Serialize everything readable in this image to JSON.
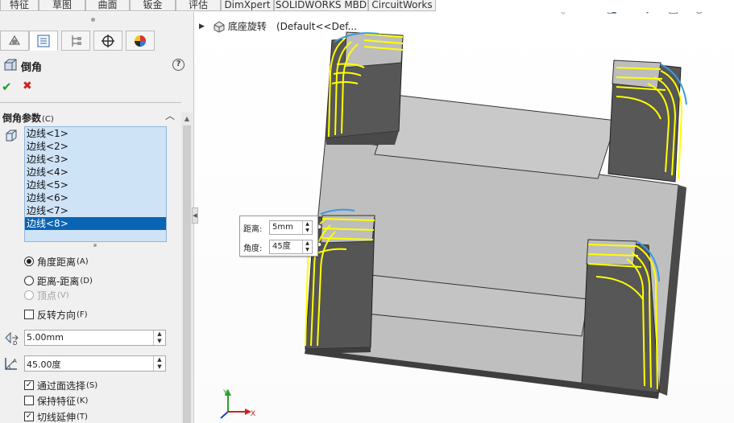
{
  "tabs": [
    "特征",
    "草图",
    "曲面",
    "钣金",
    "评估",
    "DimXpert",
    "SOLIDWORKS MBD",
    "CircuitWorks"
  ],
  "property_manager": {
    "title": "倒角",
    "help": "?",
    "ok": "✔",
    "cancel": "✖",
    "group_title": "倒角参数",
    "group_shortcut": "(C)",
    "edges": [
      "边线<1>",
      "边线<2>",
      "边线<3>",
      "边线<4>",
      "边线<5>",
      "边线<6>",
      "边线<7>",
      "边线<8>"
    ],
    "selected_edge_index": 7,
    "options": {
      "angle_distance": {
        "label": "角度距离",
        "key": "(A)",
        "selected": true
      },
      "distance_distance": {
        "label": "距离-距离",
        "key": "(D)",
        "selected": false
      },
      "vertex": {
        "label": "顶点",
        "key": "(V)",
        "selected": false,
        "disabled": true
      }
    },
    "reverse": {
      "label": "反转方向",
      "key": "(F)",
      "checked": false
    },
    "distance_value": "5.00mm",
    "angle_value": "45.00度",
    "select_through_faces": {
      "label": "通过面选择",
      "key": "(S)",
      "checked": true
    },
    "keep_features": {
      "label": "保持特征",
      "key": "(K)",
      "checked": false
    },
    "tangent_propagation": {
      "label": "切线延伸",
      "key": "(T)",
      "checked": true
    }
  },
  "viewport": {
    "part_name": "底座旋转",
    "configuration": "(Default<<Def...",
    "callout": {
      "distance_label": "距离:",
      "distance_value": "5mm",
      "angle_label": "角度:",
      "angle_value": "45度"
    },
    "triad": {
      "x": "X",
      "y": "Y"
    }
  },
  "colors": {
    "selection_yellow": "#ffff00",
    "model_dark": "#555555",
    "model_light": "#bdbdbd",
    "list_bg": "#cfe3f7",
    "list_selected": "#0a64b4",
    "edge_blue": "#3a9ae0"
  },
  "icons": [
    "search-icon",
    "zoom-area-icon",
    "previous-view-icon",
    "section-view-icon",
    "view-orientation-icon",
    "display-style-icon",
    "hide-show-icon",
    "appearance-icon",
    "scene-icon"
  ]
}
